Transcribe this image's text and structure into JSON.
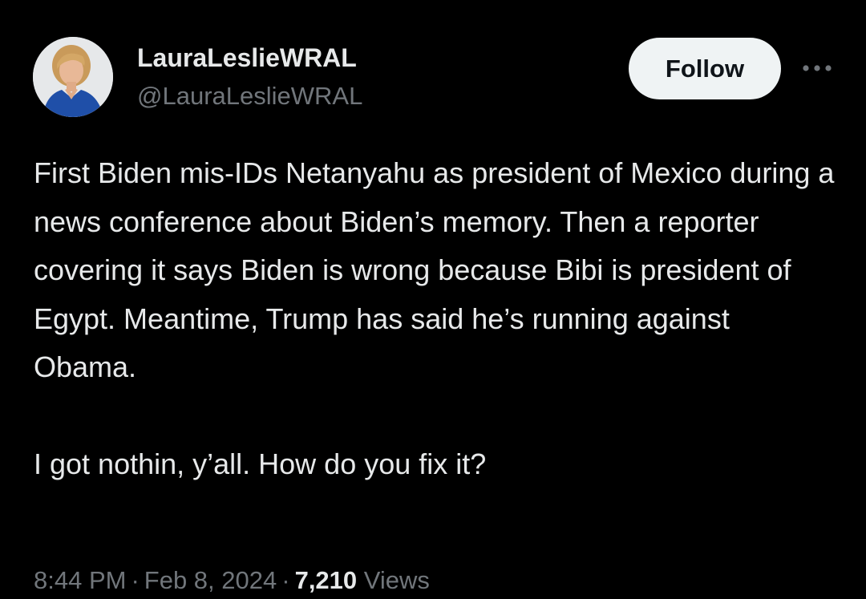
{
  "author": {
    "display_name": "LauraLeslieWRAL",
    "handle": "@LauraLeslieWRAL",
    "avatar_icon": "profile-photo"
  },
  "actions": {
    "follow_label": "Follow",
    "more_icon": "more-horizontal-icon"
  },
  "tweet": {
    "paragraphs": [
      "First Biden mis-IDs Netanyahu as president of Mexico during a news conference about Biden’s memory. Then a reporter covering it says Biden is wrong because Bibi is president of Egypt. Meantime, Trump has said he’s running against Obama.",
      "I got nothin, y’all. How do you fix it?"
    ]
  },
  "meta": {
    "time": "8:44 PM",
    "separator": "·",
    "date": "Feb 8, 2024",
    "views_count": "7,210",
    "views_label": "Views"
  },
  "colors": {
    "background": "#000000",
    "primary_text": "#e7e9ea",
    "secondary_text": "#71767b",
    "follow_bg": "#eff3f4",
    "follow_text": "#0f1419"
  }
}
